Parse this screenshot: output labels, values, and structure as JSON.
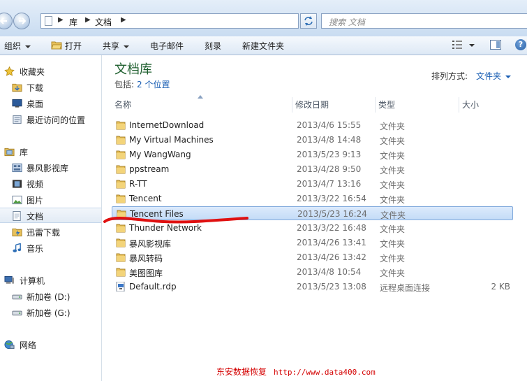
{
  "address": {
    "crumbs": [
      "库",
      "文档"
    ],
    "search_placeholder": "搜索 文档"
  },
  "toolbar": {
    "organize": "组织",
    "open": "打开",
    "share": "共享",
    "email": "电子邮件",
    "burn": "刻录",
    "new_folder": "新建文件夹"
  },
  "sidebar": {
    "favorites": {
      "label": "收藏夹",
      "items": [
        "下载",
        "桌面",
        "最近访问的位置"
      ]
    },
    "libraries": {
      "label": "库",
      "items": [
        "暴风影视库",
        "视频",
        "图片",
        "文档",
        "迅雷下载",
        "音乐"
      ]
    },
    "computer": {
      "label": "计算机",
      "items": [
        "新加卷 (D:)",
        "新加卷 (G:)"
      ]
    },
    "network": {
      "label": "网络"
    }
  },
  "library": {
    "title": "文档库",
    "includes_label": "包括:",
    "includes_link": "2 个位置",
    "arrange_label": "排列方式:",
    "arrange_value": "文件夹"
  },
  "columns": {
    "name": "名称",
    "modified": "修改日期",
    "type": "类型",
    "size": "大小"
  },
  "files": [
    {
      "name": "InternetDownload",
      "date": "2013/4/6 15:55",
      "type": "文件夹",
      "size": ""
    },
    {
      "name": "My Virtual Machines",
      "date": "2013/4/8 14:48",
      "type": "文件夹",
      "size": ""
    },
    {
      "name": "My WangWang",
      "date": "2013/5/23 9:13",
      "type": "文件夹",
      "size": ""
    },
    {
      "name": "ppstream",
      "date": "2013/4/28 9:50",
      "type": "文件夹",
      "size": ""
    },
    {
      "name": "R-TT",
      "date": "2013/4/7 13:16",
      "type": "文件夹",
      "size": ""
    },
    {
      "name": "Tencent",
      "date": "2013/3/22 16:54",
      "type": "文件夹",
      "size": ""
    },
    {
      "name": "Tencent Files",
      "date": "2013/5/23 16:24",
      "type": "文件夹",
      "size": ""
    },
    {
      "name": "Thunder Network",
      "date": "2013/3/22 16:48",
      "type": "文件夹",
      "size": ""
    },
    {
      "name": "暴风影视库",
      "date": "2013/4/26 13:41",
      "type": "文件夹",
      "size": ""
    },
    {
      "name": "暴风转码",
      "date": "2013/4/26 13:42",
      "type": "文件夹",
      "size": ""
    },
    {
      "name": "美图图库",
      "date": "2013/4/8 10:54",
      "type": "文件夹",
      "size": ""
    },
    {
      "name": "Default.rdp",
      "date": "2013/5/23 13:08",
      "type": "远程桌面连接",
      "size": "2 KB"
    }
  ],
  "selected_row": "Tencent Files",
  "watermark": {
    "text": "东安数据恢复",
    "url": "http://www.data400.com"
  }
}
